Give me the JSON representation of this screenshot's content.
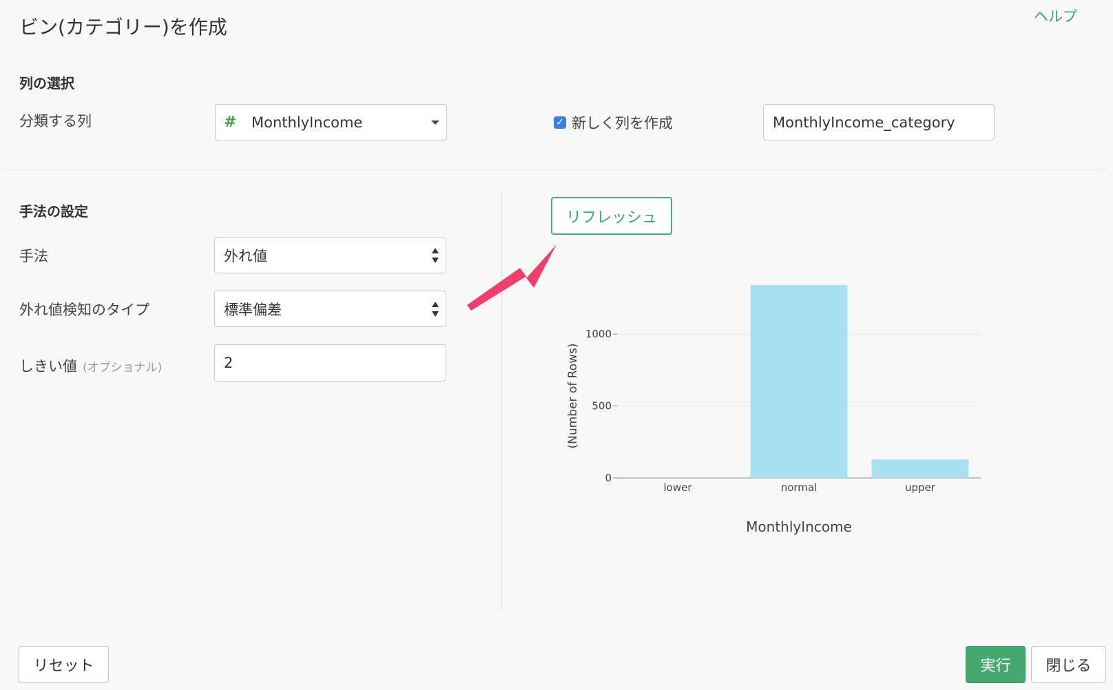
{
  "dialog": {
    "title": "ビン(カテゴリー)を作成",
    "help_link": "ヘルプ"
  },
  "column_section": {
    "title": "列の選択",
    "classify_label": "分類する列",
    "column_type_icon": "#",
    "column_value": "MonthlyIncome",
    "new_column_checkbox_label": "新しく列を作成",
    "new_column_checked": true,
    "new_column_name": "MonthlyIncome_category"
  },
  "method_section": {
    "title": "手法の設定",
    "method_label": "手法",
    "method_value": "外れ値",
    "outlier_type_label": "外れ値検知のタイプ",
    "outlier_type_value": "標準偏差",
    "threshold_label": "しきい値",
    "threshold_optional": "(オプショナル)",
    "threshold_value": "2"
  },
  "refresh_button": "リフレッシュ",
  "annotation_arrow_color": "#ee3f6c",
  "chart_data": {
    "type": "bar",
    "categories": [
      "lower",
      "normal",
      "upper"
    ],
    "values": [
      0,
      1340,
      128
    ],
    "xlabel": "MonthlyIncome",
    "ylabel": "(Number of Rows)",
    "ylim": [
      0,
      1350
    ],
    "yticks": [
      0,
      500,
      1000
    ],
    "bar_color": "#a8e0f2",
    "grid": true
  },
  "footer": {
    "reset_button": "リセット",
    "run_button": "実行",
    "close_button": "閉じる"
  },
  "colors": {
    "accent_green": "#44a86f",
    "checkbox_blue": "#3b7de0"
  }
}
